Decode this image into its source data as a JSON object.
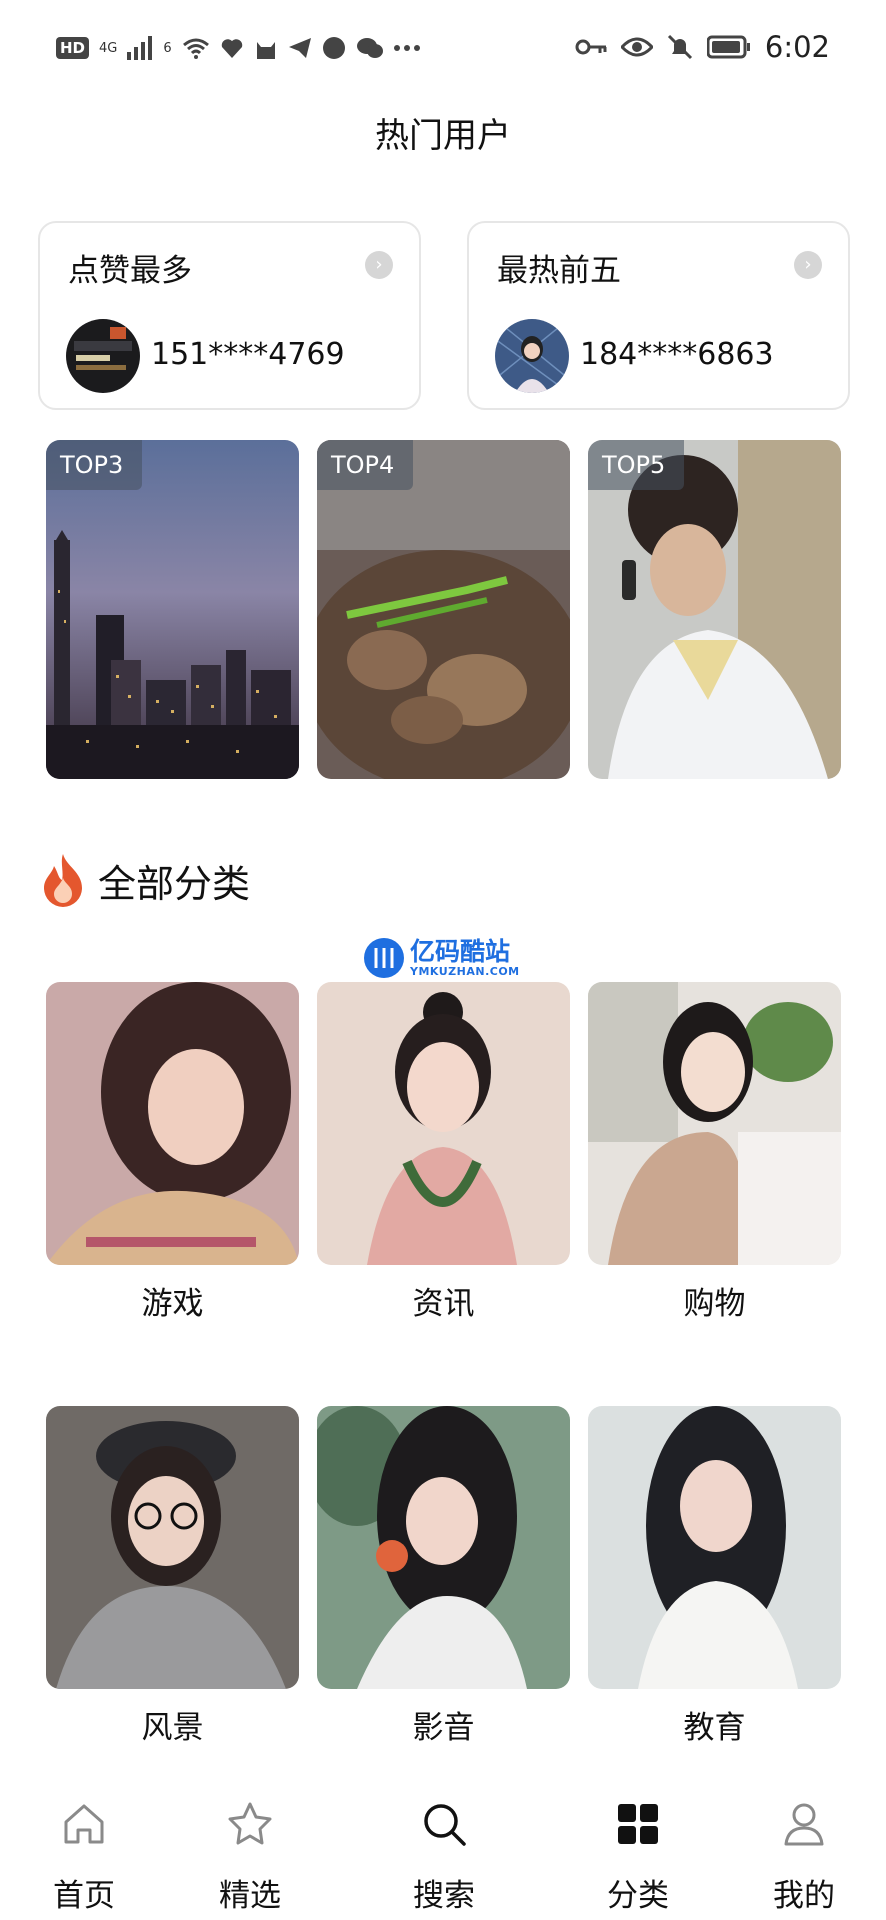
{
  "status_bar": {
    "left_badges": [
      "HD",
      "4G",
      "6"
    ],
    "time": "6:02"
  },
  "page": {
    "title": "热门用户"
  },
  "featured": [
    {
      "title": "点赞最多",
      "phone": "151****4769"
    },
    {
      "title": "最热前五",
      "phone": "184****6863"
    }
  ],
  "top_tiles": [
    {
      "badge": "TOP3",
      "subject": "city-night-skyline"
    },
    {
      "badge": "TOP4",
      "subject": "food-dish"
    },
    {
      "badge": "TOP5",
      "subject": "man-on-phone"
    }
  ],
  "categories_section": {
    "title": "全部分类",
    "icon": "fire-icon"
  },
  "watermark": {
    "cn": "亿码酷站",
    "en": "YMKUZHAN.COM"
  },
  "categories": [
    {
      "label": "游戏"
    },
    {
      "label": "资讯"
    },
    {
      "label": "购物"
    },
    {
      "label": "风景"
    },
    {
      "label": "影音"
    },
    {
      "label": "教育"
    }
  ],
  "bottom_nav": [
    {
      "label": "首页",
      "icon": "home-icon",
      "active": false
    },
    {
      "label": "精选",
      "icon": "star-icon",
      "active": false
    },
    {
      "label": "搜索",
      "icon": "search-icon",
      "active": false
    },
    {
      "label": "分类",
      "icon": "grid-icon",
      "active": true
    },
    {
      "label": "我的",
      "icon": "user-icon",
      "active": false
    }
  ],
  "colors": {
    "accent": "#1f6fe0",
    "fire": "#e4572e",
    "nav_icon": "#8a8a8a",
    "nav_active": "#111111"
  }
}
